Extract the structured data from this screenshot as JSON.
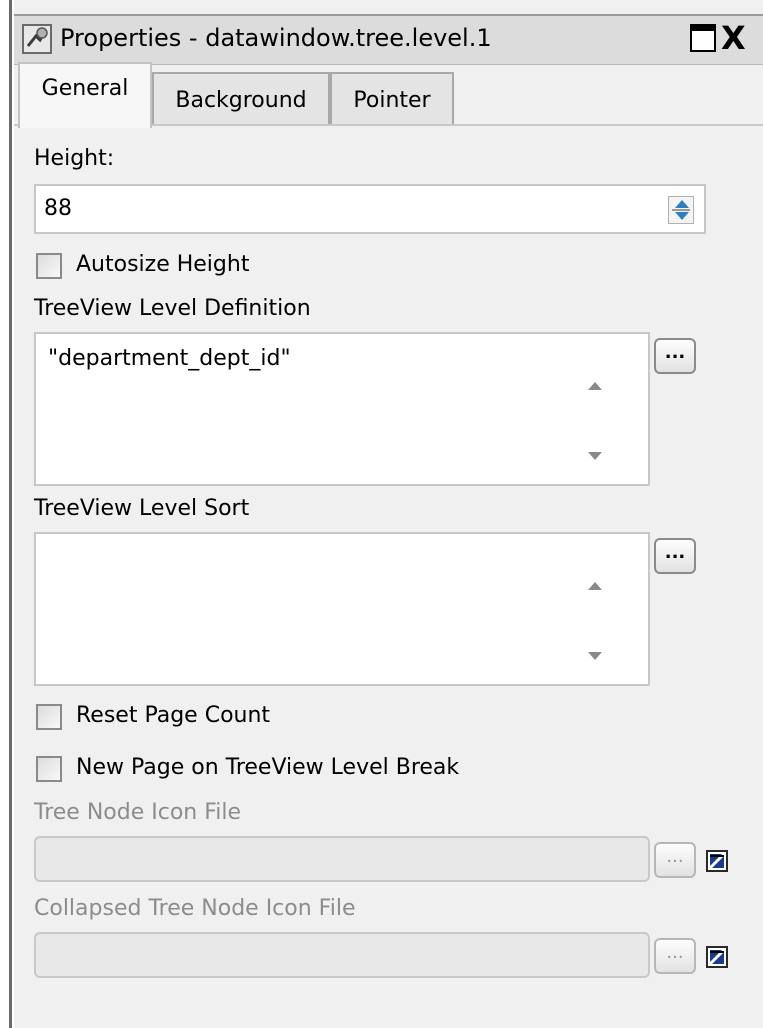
{
  "window": {
    "title": "Properties - datawindow.tree.level.1",
    "title_icon": "properties-icon",
    "maximize_icon": "maximize-icon",
    "close_label": "X"
  },
  "tabs": [
    {
      "label": "General",
      "active": true
    },
    {
      "label": "Background",
      "active": false
    },
    {
      "label": "Pointer",
      "active": false
    }
  ],
  "general": {
    "height_label": "Height:",
    "height_value": "88",
    "autosize_label": "Autosize Height",
    "autosize_checked": false,
    "level_definition_label": "TreeView Level Definition",
    "level_definition_value": "\"department_dept_id\"",
    "level_sort_label": "TreeView Level Sort",
    "level_sort_value": "",
    "reset_page_count_label": "Reset Page Count",
    "reset_page_count_checked": false,
    "new_page_label": "New Page on TreeView Level Break",
    "new_page_checked": false,
    "tree_node_icon_label": "Tree Node Icon File",
    "tree_node_icon_value": "",
    "collapsed_icon_label": "Collapsed Tree Node Icon File",
    "collapsed_icon_value": "",
    "ellipsis_label": "..."
  },
  "colors": {
    "window_bg": "#f0f0f0",
    "disabled_text": "#8c8c8c",
    "spinner_accent": "#2e7fc2"
  }
}
